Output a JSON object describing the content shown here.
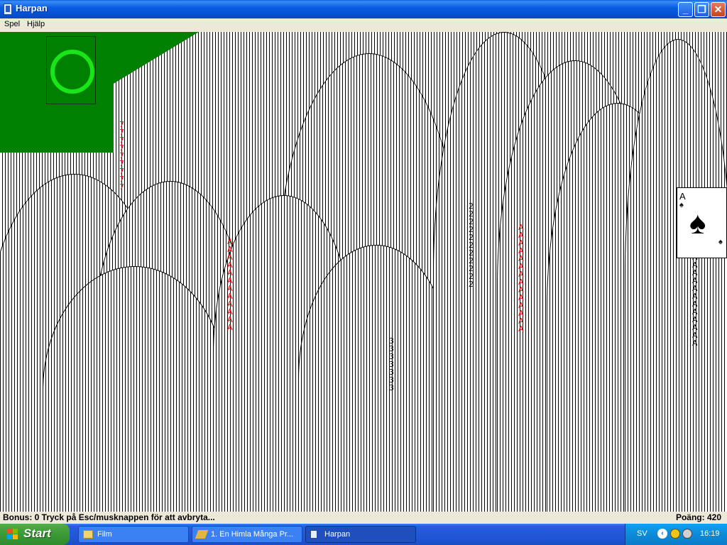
{
  "window": {
    "title": "Harpan",
    "buttons": {
      "minimize": "_",
      "maximize": "❐",
      "close": "✕"
    }
  },
  "menu": {
    "items": [
      "Spel",
      "Hjälp"
    ]
  },
  "game": {
    "card_trails": {
      "red": "7\n7\n7\n7\n7\n7\n7\n7\n7",
      "red2": "A\nA\nA\nA\nA\nA\nA\nA\nA\nA\nA\nA",
      "red3": "A\nA\nA\nA\nA\nA\nA\nA\nA\nA\nA\nA\nA\nA",
      "black": "2\n2\n2\n2\n2\n2\n2\n2\n2\n2\n2",
      "black2": "3\n3\n3\n3\n3\n3\n3",
      "black3": "A\nA\nA\nA\nA\nA\nA\nA\nA\nA\nA\nA\nA\nA"
    },
    "ace_card": {
      "rank": "A",
      "suit": "♠"
    }
  },
  "status": {
    "left": "Bonus: 0  Tryck på Esc/musknappen för att avbryta...",
    "right": "Poäng: 420"
  },
  "taskbar": {
    "start_label": "Start",
    "tasks": [
      {
        "label": "Film"
      },
      {
        "label": "1. En Himla Många Pr..."
      },
      {
        "label": "Harpan"
      }
    ],
    "tray": {
      "language": "SV",
      "arrow": "‹",
      "clock": "16:19"
    }
  },
  "colors": {
    "felt": "#008000",
    "stock_ring": "#19e619",
    "titlebar": "#0653d6",
    "taskbar": "#245edb",
    "start": "#3b9a36"
  }
}
